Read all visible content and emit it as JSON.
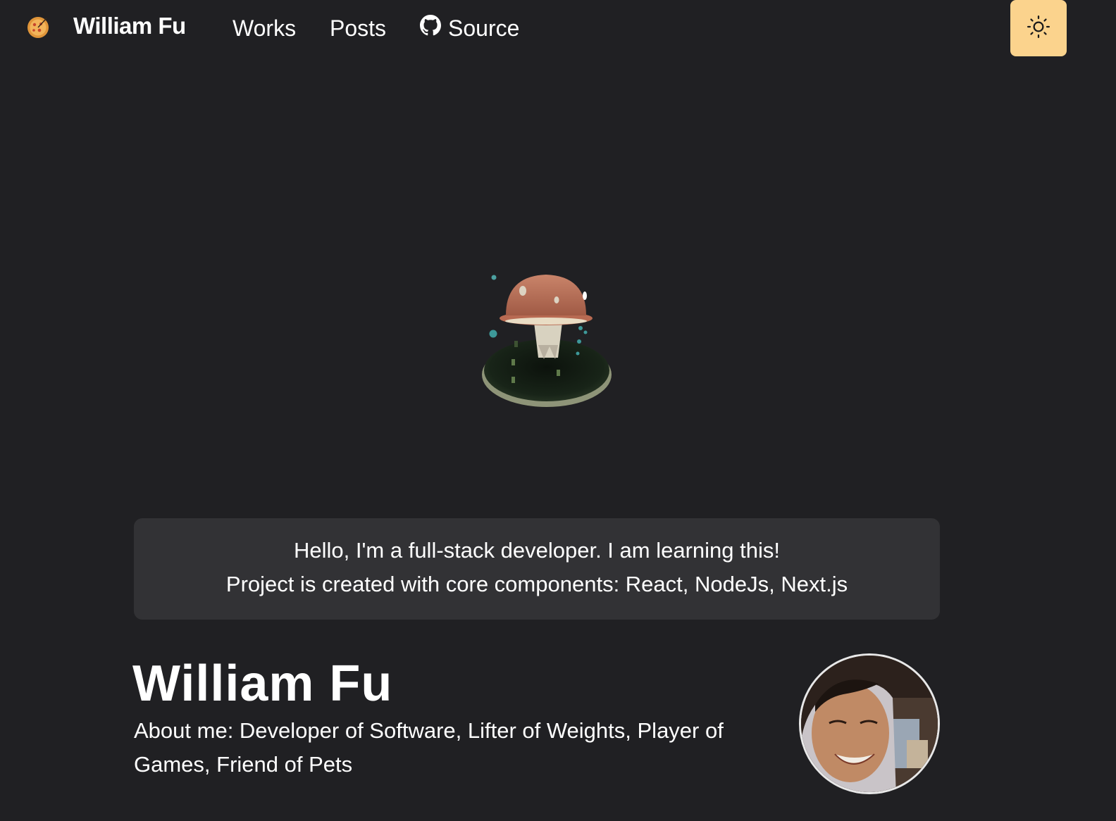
{
  "nav": {
    "brand": "William Fu",
    "logo_icon": "pizza-icon",
    "links": [
      {
        "label": "Works"
      },
      {
        "label": "Posts"
      },
      {
        "label": "Source",
        "icon": "github-icon"
      }
    ],
    "theme_toggle_icon": "sun-icon",
    "theme_toggle_color": "#fbd38d"
  },
  "hero": {
    "scene_icon": "mushroom-voxel-model"
  },
  "intro": {
    "line1": "Hello, I'm a full-stack developer. I am learning this!",
    "line2": "Project is created with core components: React, NodeJs, Next.js"
  },
  "profile": {
    "name": "William Fu",
    "about": "About me: Developer of Software, Lifter of Weights, Player of Games, Friend of Pets",
    "avatar_icon": "profile-photo"
  },
  "colors": {
    "background": "#202023",
    "card": "#323235",
    "accent": "#fbd38d"
  }
}
